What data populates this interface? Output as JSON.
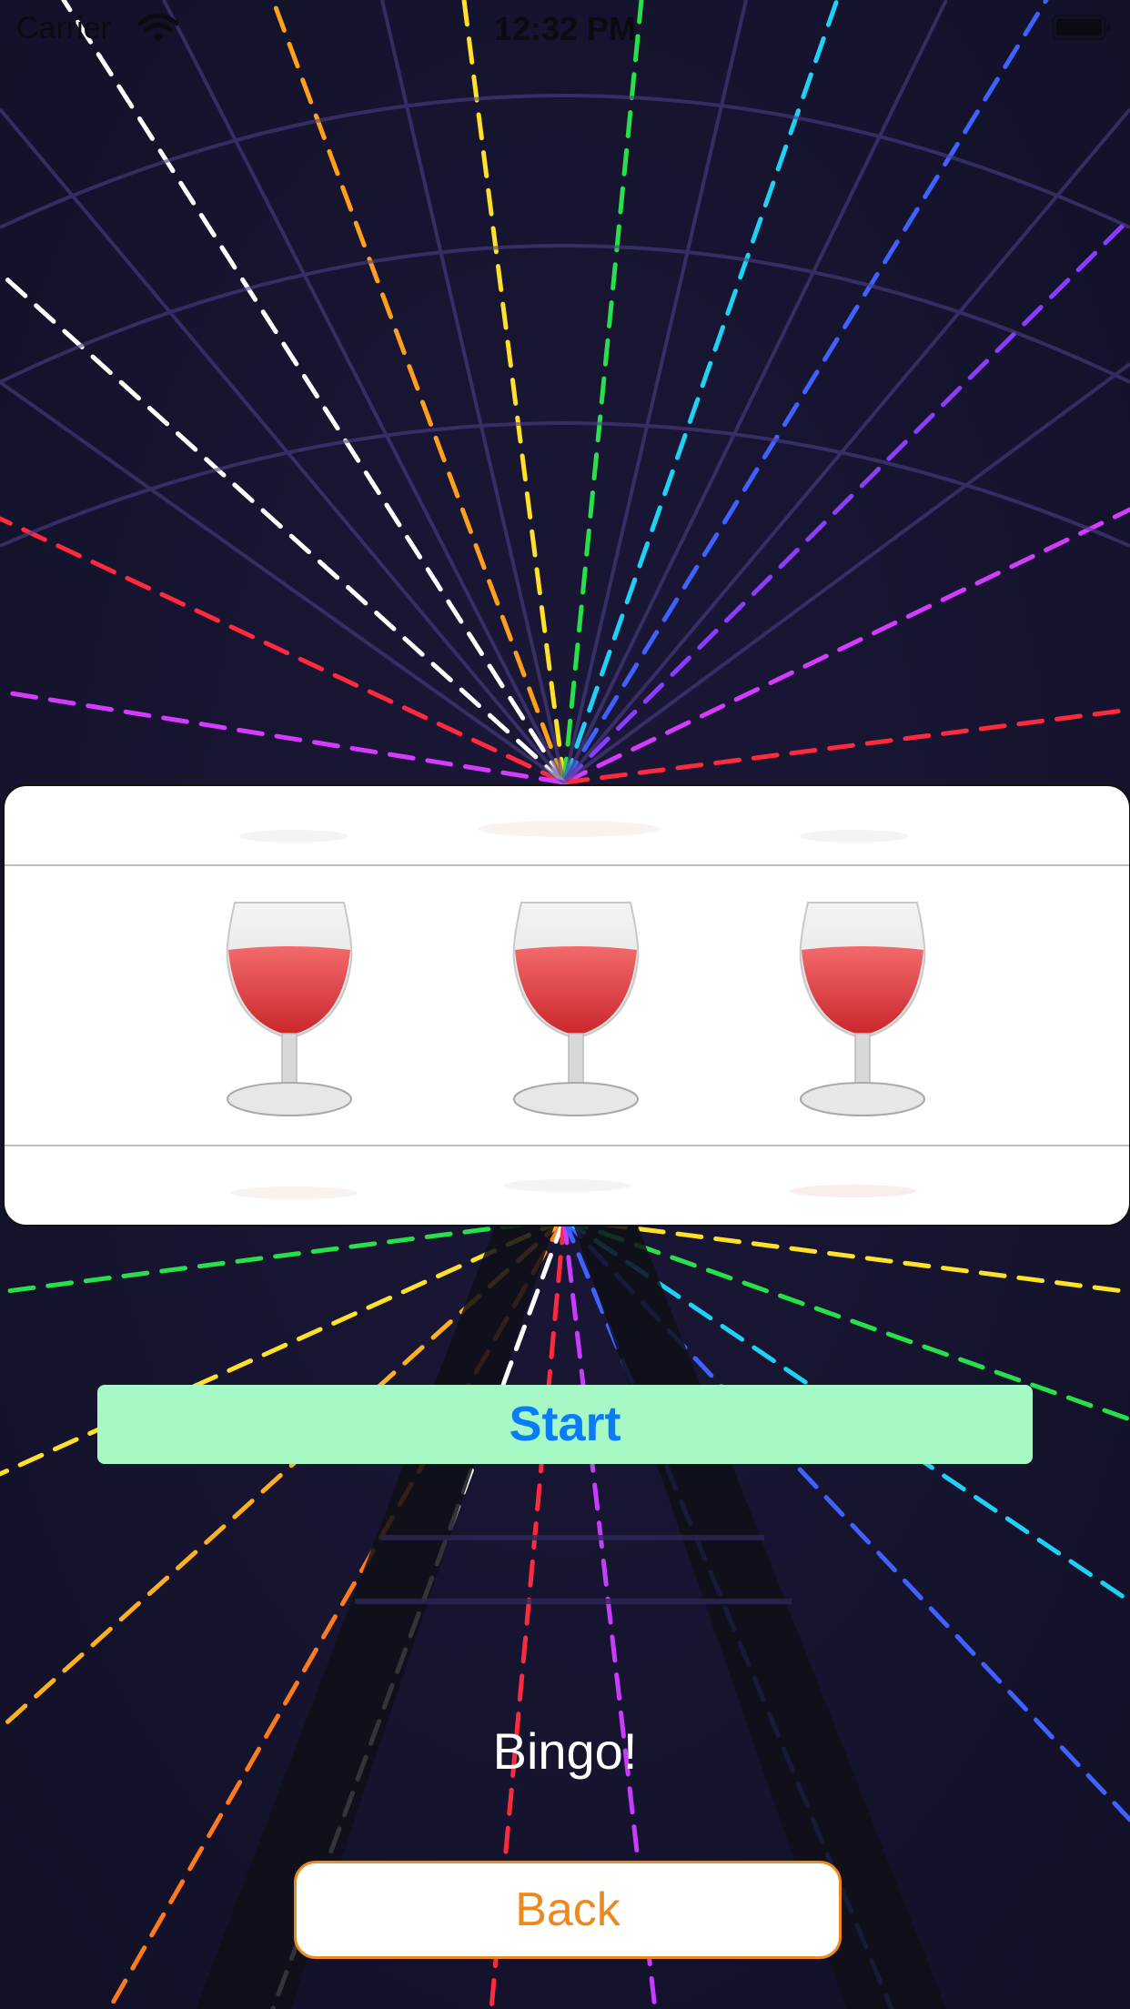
{
  "status_bar": {
    "carrier": "Carrier",
    "time": "12:32 PM",
    "icons": [
      "wifi-icon",
      "battery-icon"
    ]
  },
  "picker": {
    "selected_row": [
      "wine-glass",
      "wine-glass",
      "wine-glass"
    ]
  },
  "start_button": {
    "label": "Start",
    "background": "#a6f8c4",
    "text_color": "#0a7cf7"
  },
  "result_text": "Bingo!",
  "back_button": {
    "label": "Back",
    "accent": "#ee8a1d"
  }
}
